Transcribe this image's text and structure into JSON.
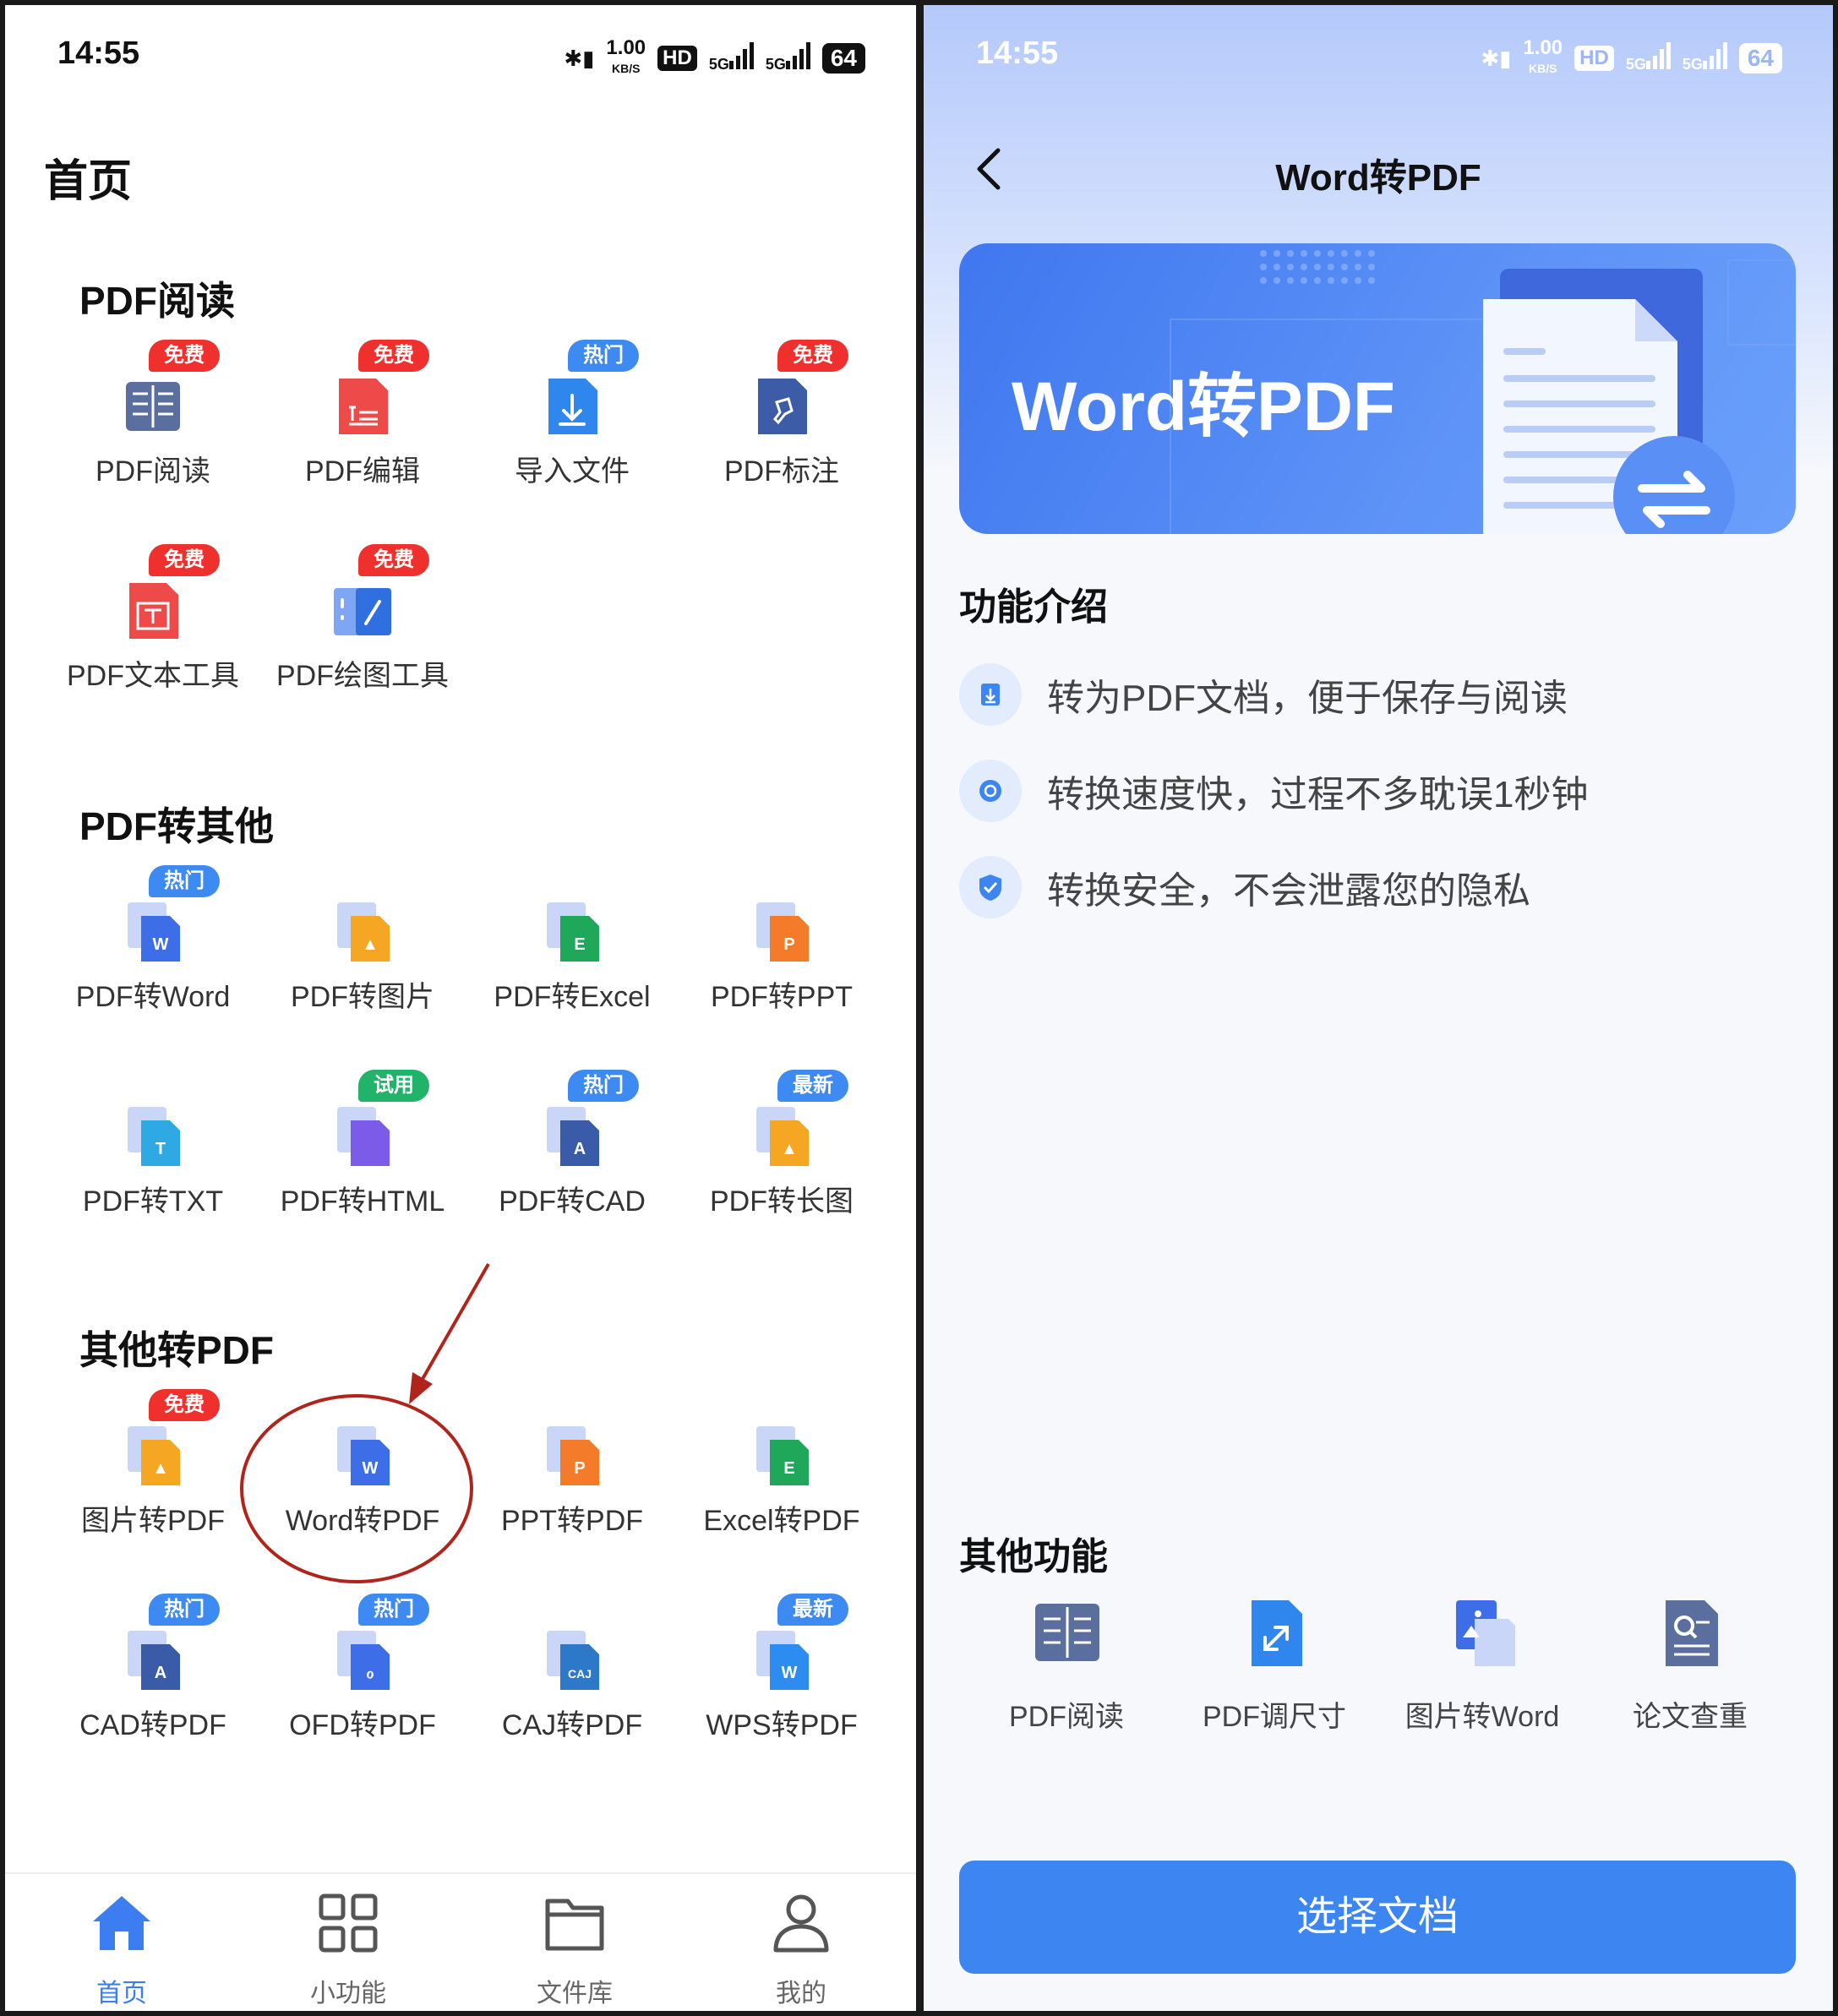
{
  "status": {
    "time": "14:55",
    "speed": "1.00",
    "speed_unit": "KB/S",
    "hd": "HD",
    "net1": "5G",
    "net2": "5G",
    "battery": "64"
  },
  "left": {
    "title": "首页",
    "sections": [
      {
        "title": "PDF阅读",
        "items": [
          {
            "label": "PDF阅读",
            "badge": "免费",
            "badge_type": "free",
            "icon": "book-icon"
          },
          {
            "label": "PDF编辑",
            "badge": "免费",
            "badge_type": "free",
            "icon": "edit-doc-icon"
          },
          {
            "label": "导入文件",
            "badge": "热门",
            "badge_type": "hot",
            "icon": "import-icon"
          },
          {
            "label": "PDF标注",
            "badge": "免费",
            "badge_type": "free",
            "icon": "pin-icon"
          },
          {
            "label": "PDF文本工具",
            "badge": "免费",
            "badge_type": "free",
            "icon": "text-tool-icon"
          },
          {
            "label": "PDF绘图工具",
            "badge": "免费",
            "badge_type": "free",
            "icon": "draw-tool-icon"
          }
        ]
      },
      {
        "title": "PDF转其他",
        "items": [
          {
            "label": "PDF转Word",
            "badge": "热门",
            "badge_type": "hot",
            "icon": "word-doc-icon",
            "glyph": "W",
            "color": "#3d6ee8"
          },
          {
            "label": "PDF转图片",
            "badge": "",
            "badge_type": "",
            "icon": "image-doc-icon",
            "glyph": "▲",
            "color": "#f5a623"
          },
          {
            "label": "PDF转Excel",
            "badge": "",
            "badge_type": "",
            "icon": "excel-doc-icon",
            "glyph": "E",
            "color": "#1fa85a"
          },
          {
            "label": "PDF转PPT",
            "badge": "",
            "badge_type": "",
            "icon": "ppt-doc-icon",
            "glyph": "P",
            "color": "#f47b2a"
          },
          {
            "label": "PDF转TXT",
            "badge": "",
            "badge_type": "",
            "icon": "txt-doc-icon",
            "glyph": "T",
            "color": "#2fa9e3"
          },
          {
            "label": "PDF转HTML",
            "badge": "试用",
            "badge_type": "trial",
            "icon": "html-doc-icon",
            "glyph": "</>",
            "color": "#7b5be8"
          },
          {
            "label": "PDF转CAD",
            "badge": "热门",
            "badge_type": "hot",
            "icon": "cad-doc-icon",
            "glyph": "A",
            "color": "#3a5ba8"
          },
          {
            "label": "PDF转长图",
            "badge": "最新",
            "badge_type": "new",
            "icon": "long-image-icon",
            "glyph": "▲",
            "color": "#f5a623"
          }
        ]
      },
      {
        "title": "其他转PDF",
        "items": [
          {
            "label": "图片转PDF",
            "badge": "免费",
            "badge_type": "free",
            "icon": "image-to-pdf-icon",
            "glyph": "▲",
            "color": "#f5a623"
          },
          {
            "label": "Word转PDF",
            "badge": "",
            "badge_type": "",
            "icon": "word-to-pdf-icon",
            "glyph": "W",
            "color": "#3d6ee8"
          },
          {
            "label": "PPT转PDF",
            "badge": "",
            "badge_type": "",
            "icon": "ppt-to-pdf-icon",
            "glyph": "P",
            "color": "#f47b2a"
          },
          {
            "label": "Excel转PDF",
            "badge": "",
            "badge_type": "",
            "icon": "excel-to-pdf-icon",
            "glyph": "E",
            "color": "#1fa85a"
          },
          {
            "label": "CAD转PDF",
            "badge": "热门",
            "badge_type": "hot",
            "icon": "cad-to-pdf-icon",
            "glyph": "A",
            "color": "#3a5ba8"
          },
          {
            "label": "OFD转PDF",
            "badge": "热门",
            "badge_type": "hot",
            "icon": "ofd-to-pdf-icon",
            "glyph": "ℴ",
            "color": "#3d6ee8"
          },
          {
            "label": "CAJ转PDF",
            "badge": "",
            "badge_type": "",
            "icon": "caj-to-pdf-icon",
            "glyph": "CAJ",
            "color": "#2d78c8"
          },
          {
            "label": "WPS转PDF",
            "badge": "最新",
            "badge_type": "new",
            "icon": "wps-to-pdf-icon",
            "glyph": "W",
            "color": "#2d8cf0"
          }
        ]
      }
    ],
    "tabs": [
      {
        "label": "首页",
        "icon": "home-icon",
        "active": true
      },
      {
        "label": "小功能",
        "icon": "grid-icon",
        "active": false
      },
      {
        "label": "文件库",
        "icon": "folder-icon",
        "active": false
      },
      {
        "label": "我的",
        "icon": "user-icon",
        "active": false
      }
    ]
  },
  "right": {
    "nav_title": "Word转PDF",
    "banner_title": "Word转PDF",
    "intro_title": "功能介绍",
    "intro": [
      {
        "text": "转为PDF文档，便于保存与阅读",
        "icon": "download-icon"
      },
      {
        "text": "转换速度快，过程不多耽误1秒钟",
        "icon": "clock-icon"
      },
      {
        "text": "转换安全，不会泄露您的隐私",
        "icon": "shield-icon"
      }
    ],
    "other_title": "其他功能",
    "other": [
      {
        "label": "PDF阅读",
        "icon": "book-icon"
      },
      {
        "label": "PDF调尺寸",
        "icon": "resize-icon"
      },
      {
        "label": "图片转Word",
        "icon": "image-word-icon"
      },
      {
        "label": "论文查重",
        "icon": "thesis-check-icon"
      }
    ],
    "select_button": "选择文档"
  },
  "colors": {
    "accent": "#3d86f2",
    "free_badge": "#f0302c",
    "hot_badge": "#3d8bf2",
    "trial_badge": "#21b36a",
    "annotation": "#b0241c"
  }
}
